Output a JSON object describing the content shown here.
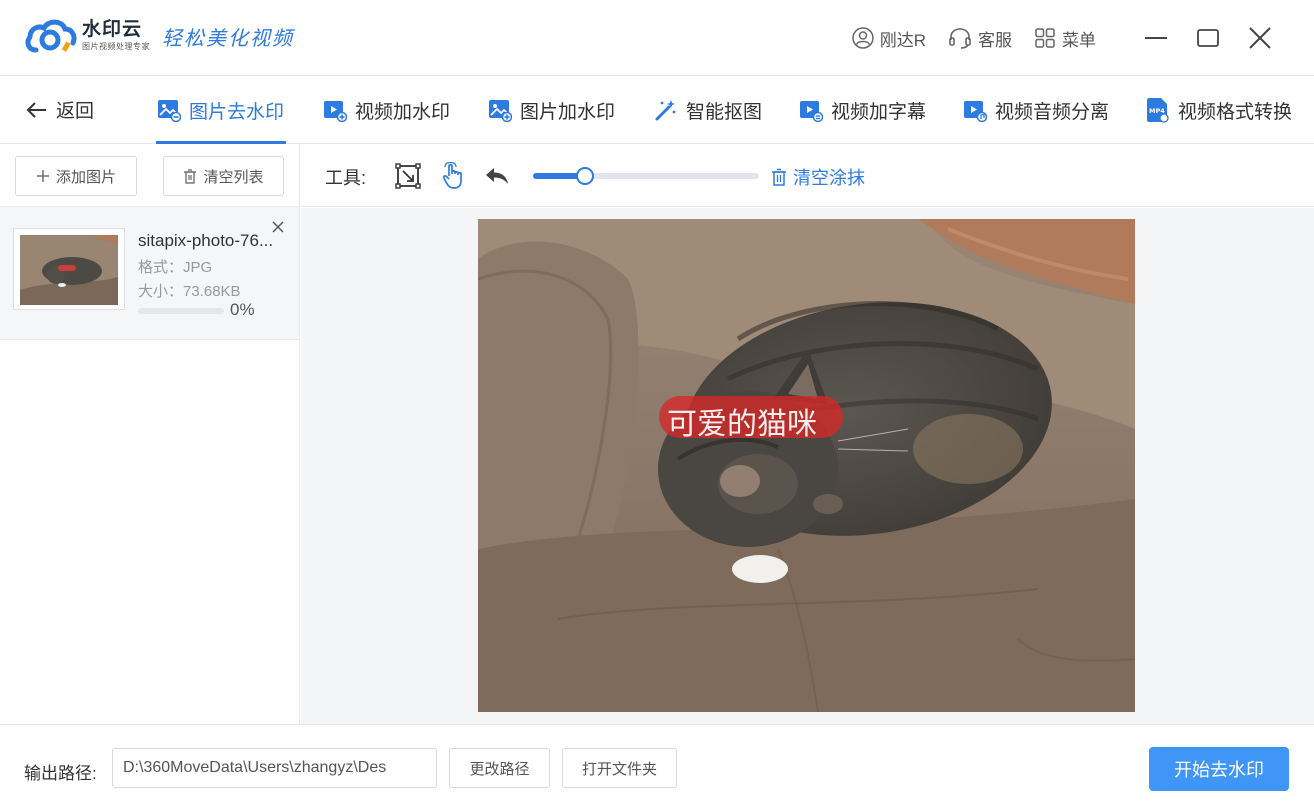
{
  "app": {
    "name": "水印云",
    "subtitle": "图片视频处理专家",
    "slogan": "轻松美化视频"
  },
  "titlebar": {
    "user": "刚达R",
    "service": "客服",
    "menu": "菜单"
  },
  "nav": {
    "back": "返回",
    "tabs": [
      {
        "label": "图片去水印",
        "icon": "image-remove-icon"
      },
      {
        "label": "视频加水印",
        "icon": "video-add-icon"
      },
      {
        "label": "图片加水印",
        "icon": "image-add-icon"
      },
      {
        "label": "智能抠图",
        "icon": "magic-wand-icon"
      },
      {
        "label": "视频加字幕",
        "icon": "video-subtitle-icon"
      },
      {
        "label": "视频音频分离",
        "icon": "video-audio-icon"
      },
      {
        "label": "视频格式转换",
        "icon": "mp4-icon"
      }
    ],
    "active_tab": 0
  },
  "left": {
    "add_label": "添加图片",
    "clear_label": "清空列表",
    "file": {
      "name": "sitapix-photo-76...",
      "format": "格式：JPG",
      "size": "大小：73.68KB",
      "progress": "0%",
      "progress_value": 0
    }
  },
  "toolbar": {
    "label": "工具:",
    "slider_value": 0.23,
    "clear_label": "清空涂抹"
  },
  "canvas": {
    "watermark_text": "可爱的猫咪"
  },
  "bottom": {
    "output_label": "输出路径:",
    "path": "D:\\360MoveData\\Users\\zhangyz\\Des",
    "change_path": "更改路径",
    "open_folder": "打开文件夹",
    "start": "开始去水印"
  },
  "colors": {
    "accent": "#2d7be0",
    "primary_button": "#4096f7",
    "mask": "#d62828"
  }
}
